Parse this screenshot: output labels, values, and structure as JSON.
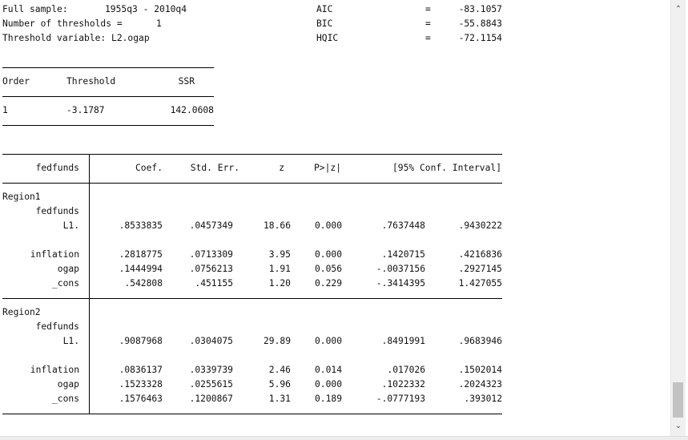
{
  "header": {
    "left": [
      {
        "label": "Full sample:",
        "value": "1955q3 - 2010q4"
      },
      {
        "label": "Number of thresholds =",
        "value": "1"
      },
      {
        "label": "Threshold variable: L2.ogap",
        "value": ""
      }
    ],
    "criteria": [
      {
        "label": "AIC",
        "eq": "=",
        "value": "-83.1057"
      },
      {
        "label": "BIC",
        "eq": "=",
        "value": "-55.8843"
      },
      {
        "label": "HQIC",
        "eq": "=",
        "value": "-72.1154"
      }
    ]
  },
  "threshold_table": {
    "headers": [
      "Order",
      "Threshold",
      "SSR"
    ],
    "row": [
      "1",
      "-3.1787",
      "142.0608"
    ]
  },
  "coef_table": {
    "depvar": "fedfunds",
    "headers": [
      "Coef.",
      "Std. Err.",
      "z",
      "P>|z|",
      "[95% Conf. Interval]"
    ],
    "regions": [
      {
        "name": "Region1",
        "sub": "fedfunds",
        "rows": [
          [
            "L1.",
            ".8533835",
            ".0457349",
            "18.66",
            "0.000",
            ".7637448",
            ".9430222"
          ],
          [
            "inflation",
            ".2818775",
            ".0713309",
            "3.95",
            "0.000",
            ".1420715",
            ".4216836"
          ],
          [
            "ogap",
            ".1444994",
            ".0756213",
            "1.91",
            "0.056",
            "-.0037156",
            ".2927145"
          ],
          [
            "_cons",
            ".542808",
            ".451155",
            "1.20",
            "0.229",
            "-.3414395",
            "1.427055"
          ]
        ]
      },
      {
        "name": "Region2",
        "sub": "fedfunds",
        "rows": [
          [
            "L1.",
            ".9087968",
            ".0304075",
            "29.89",
            "0.000",
            ".8491991",
            ".9683946"
          ],
          [
            "inflation",
            ".0836137",
            ".0339739",
            "2.46",
            "0.014",
            ".017026",
            ".1502014"
          ],
          [
            "ogap",
            ".1523328",
            ".0255615",
            "5.96",
            "0.000",
            ".1022332",
            ".2024323"
          ],
          [
            "_cons",
            ".1576463",
            ".1200867",
            "1.31",
            "0.189",
            "-.0777193",
            ".393012"
          ]
        ]
      }
    ]
  },
  "scrollbar": {
    "up_icon": "chevron-up-icon",
    "down_icon": "chevron-down-icon"
  }
}
